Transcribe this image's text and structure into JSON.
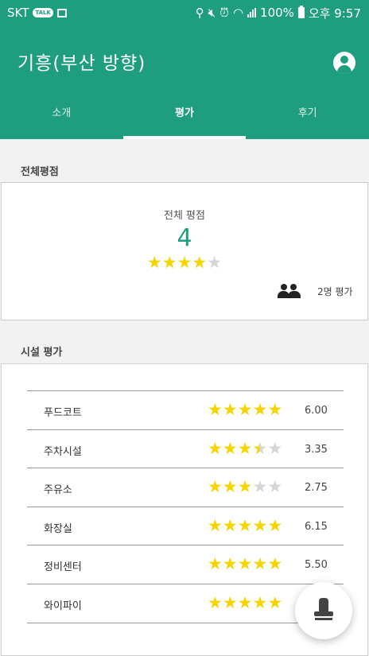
{
  "status_bar": {
    "carrier": "SKT",
    "talk_badge": "TALK",
    "battery_percent": "100%",
    "time": "오후 9:57"
  },
  "app_bar": {
    "title": "기흥(부산 방향)",
    "account_icon": "account-circle-icon"
  },
  "tabs": [
    {
      "label": "소개",
      "active": false
    },
    {
      "label": "평가",
      "active": true
    },
    {
      "label": "후기",
      "active": false
    }
  ],
  "overall": {
    "section_label": "전체평점",
    "card_title": "전체 평점",
    "score": "4",
    "stars": 4,
    "max_stars": 5,
    "reviewer_count": "2명 평가",
    "people_icon": "people-icon"
  },
  "facilities": {
    "section_label": "시설 평가",
    "rows": [
      {
        "name": "푸드코트",
        "stars": 5,
        "score": "6.00"
      },
      {
        "name": "주차시설",
        "stars": 3.5,
        "score": "3.35"
      },
      {
        "name": "주유소",
        "stars": 3,
        "score": "2.75"
      },
      {
        "name": "화장실",
        "stars": 5,
        "score": "6.15"
      },
      {
        "name": "정비센터",
        "stars": 5,
        "score": "5.50"
      },
      {
        "name": "와이파이",
        "stars": 5,
        "score": ""
      }
    ]
  },
  "fab": {
    "icon": "stamp-icon"
  },
  "colors": {
    "primary": "#1e9e7e",
    "star": "#f5d400",
    "star_empty": "#d6d6d6"
  }
}
